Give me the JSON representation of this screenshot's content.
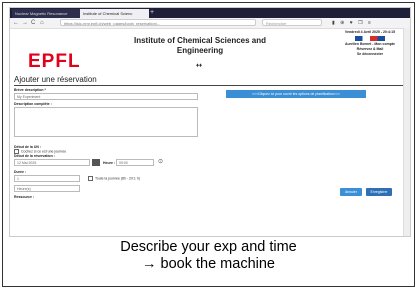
{
  "browser": {
    "tabs": [
      {
        "label": "Nuclear Magnetic Resonance"
      },
      {
        "label": "Institute of Chemical Scienc"
      }
    ],
    "new_tab": "+",
    "nav": {
      "back": "←",
      "forward": "→",
      "reload": "C",
      "home": "⌂"
    },
    "url": "https://isic-nmr.epfl.ch/web_pages/login_reservation/...",
    "search_placeholder": "Rechercher",
    "icons": "▮ ⊕ ♥ ❒ ≡"
  },
  "header": {
    "logo": "EPFL",
    "institute": "Institute of Chemical Sciences and Engineering",
    "dots": "♦♦"
  },
  "user": {
    "date": "Vendredi 4 Avril 2025 - 20:4:15",
    "line1": "Aurélien Bornet - Mon compte",
    "line2": "Réservez & Mail",
    "line3": "Se déconnecter"
  },
  "form": {
    "title": "Ajouter une réservation",
    "name_label": "Brève description *",
    "name_value": "My Experiment",
    "desc_label": "Description complète :",
    "banner": "<<<Cliquez ici pour ouvrir les options de planification>>>",
    "until_label": "Début de la UN :",
    "checkbox1": "Cochez si ce est une journée",
    "start_label": "Début de la réservation :",
    "date_value": "12    Mai    2025",
    "hour_label": "Heure :",
    "hour_value": "09:00",
    "duration_label": "Durée :",
    "duration_value": "1",
    "checkbox2": "Toute la journée (8h - 20:1 h)",
    "unit_value": "Heure(s)",
    "resource_label": "Ressource :",
    "cancel": "Annuler",
    "save": "Enregistrer"
  },
  "caption": {
    "line1": "Describe your exp and time",
    "line2": "→ book the machine"
  }
}
